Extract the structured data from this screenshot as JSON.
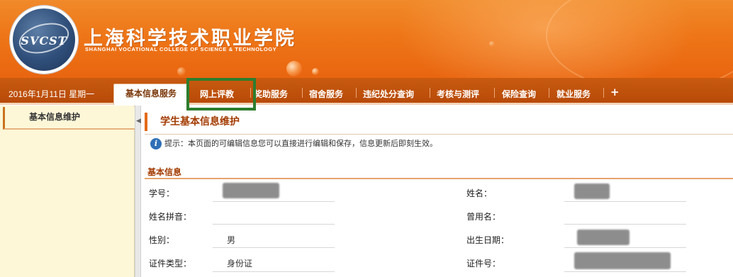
{
  "header": {
    "school_name_cn": "上海科学技术职业学院",
    "school_name_en": "SHANGHAI VOCATIONAL COLLEGE OF SCIENCE & TECHNOLOGY",
    "logo_text": "SVCST"
  },
  "navbar": {
    "date": "2016年1月11日 星期一",
    "active_tab": "基本信息服务",
    "items": [
      "网上评教",
      "奖助服务",
      "宿舍服务",
      "违纪处分查询",
      "考核与测评",
      "保险查询",
      "就业服务"
    ],
    "more": "+"
  },
  "sidebar": {
    "items": [
      {
        "label": "基本信息维护"
      }
    ]
  },
  "main": {
    "page_title": "学生基本信息维护",
    "tip": "提示：本页面的可编辑信息您可以直接进行编辑和保存，信息更新后即刻生效。",
    "section_title": "基本信息",
    "fields": {
      "student_id": {
        "label": "学号：",
        "value": ""
      },
      "name": {
        "label": "姓名：",
        "value": ""
      },
      "pinyin": {
        "label": "姓名拼音：",
        "value": ""
      },
      "former_name": {
        "label": "曾用名：",
        "value": ""
      },
      "gender": {
        "label": "性别：",
        "value": "男"
      },
      "birth_date": {
        "label": "出生日期：",
        "value": ""
      },
      "id_type": {
        "label": "证件类型：",
        "value": "身份证"
      },
      "id_number": {
        "label": "证件号：",
        "value": ""
      }
    }
  },
  "colors": {
    "header_orange": "#ee7618",
    "nav_brown": "#b84a08",
    "title_red": "#a33b00",
    "highlight_green": "#2e7d2e",
    "sidebar_bg": "#fdf7d8"
  }
}
